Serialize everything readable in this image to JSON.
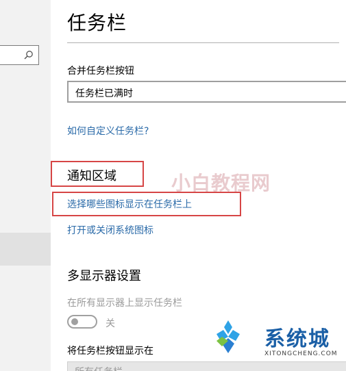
{
  "page": {
    "title": "任务栏",
    "combine_label": "合并任务栏按钮",
    "combine_value": "任务栏已满时",
    "customize_link": "如何自定义任务栏?",
    "notification_heading": "通知区域",
    "choose_icons_link": "选择哪些图标显示在任务栏上",
    "system_icons_link": "打开或关闭系统图标",
    "multi_display_heading": "多显示器设置",
    "show_all_label": "在所有显示器上显示任务栏",
    "toggle_state": "关",
    "show_buttons_label": "将任务栏按钮显示在",
    "show_buttons_value": "所有任务栏"
  },
  "nav": {
    "search_icon": "search-icon"
  },
  "watermark": {
    "center_text": "小白教程网",
    "brand": "系统城",
    "domain": "XITONGCHENG.COM"
  },
  "colors": {
    "link": "#2a6aa8",
    "annotation": "#d64545",
    "brand": "#1a5fa6"
  }
}
